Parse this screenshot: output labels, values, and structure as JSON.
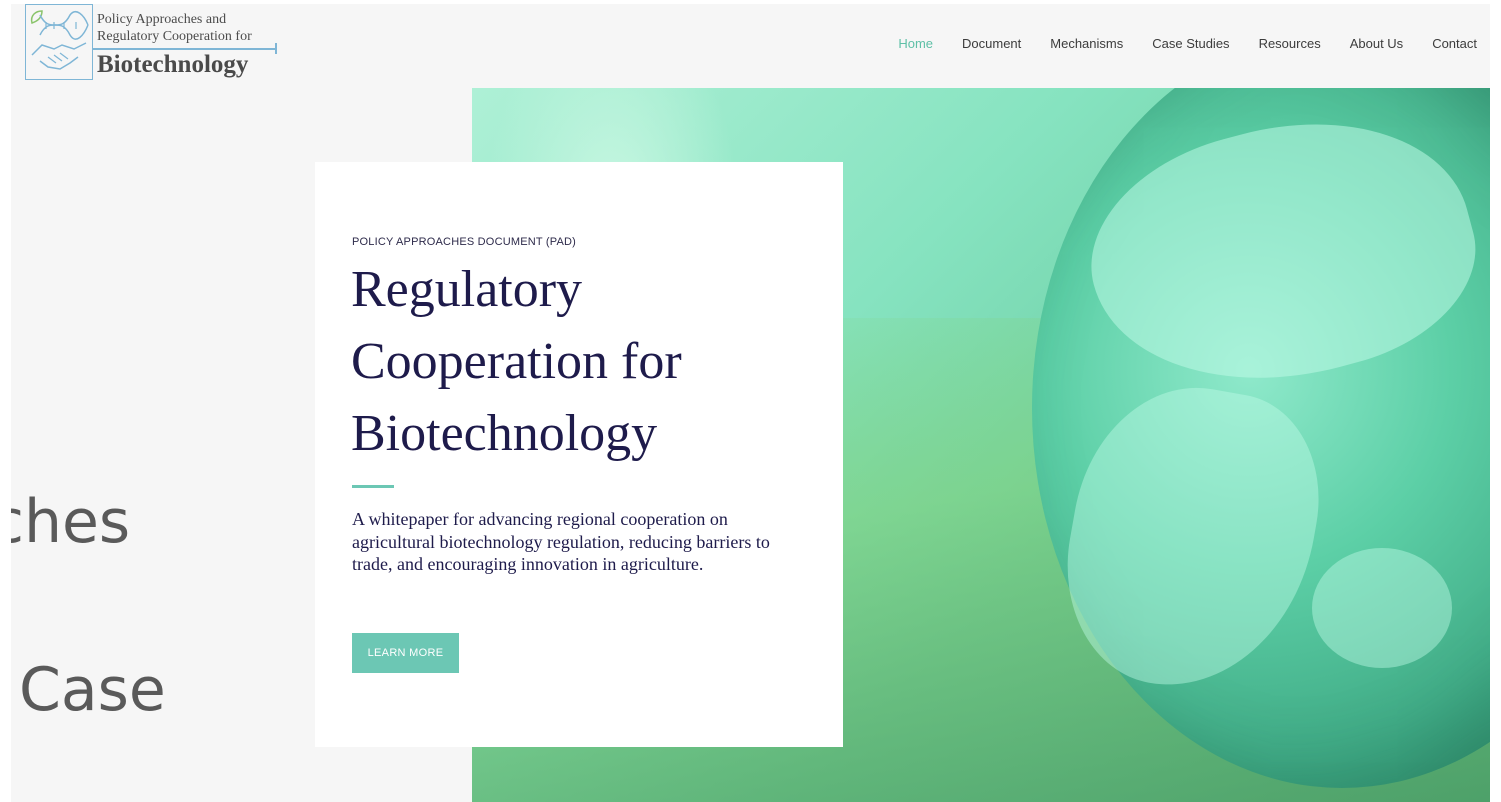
{
  "logo": {
    "line1": "Policy Approaches and",
    "line2": "Regulatory Cooperation for",
    "main": "Biotechnology"
  },
  "nav": {
    "items": [
      "Home",
      "Document",
      "Mechanisms",
      "Case Studies",
      "Resources",
      "About Us",
      "Contact"
    ],
    "active": "Home"
  },
  "background_text": {
    "line1": "ches",
    "line2": "Case"
  },
  "hero": {
    "eyebrow": "POLICY APPROACHES DOCUMENT (PAD)",
    "title": "Regulatory Cooperation for Biotechnology",
    "description": "A whitepaper for advancing regional cooperation on agricultural biotechnology regulation, reducing barriers to trade, and encouraging innovation in agriculture.",
    "button_label": "LEARN MORE"
  },
  "colors": {
    "accent": "#6cc7b4",
    "nav_active": "#5fc0a7",
    "heading": "#1e1b4b"
  }
}
